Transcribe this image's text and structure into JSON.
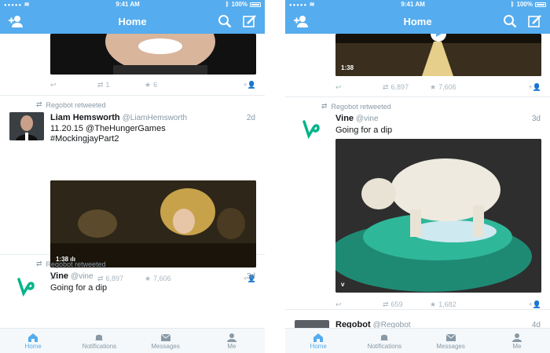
{
  "status": {
    "time": "9:41 AM",
    "battery": "100%"
  },
  "nav": {
    "title": "Home"
  },
  "tabs": [
    {
      "label": "Home",
      "icon": "home-icon",
      "active": true
    },
    {
      "label": "Notifications",
      "icon": "bell-icon",
      "active": false
    },
    {
      "label": "Messages",
      "icon": "mail-icon",
      "active": false
    },
    {
      "label": "Me",
      "icon": "person-icon",
      "active": false
    }
  ],
  "left": {
    "top_tweet": {
      "retweets": "1",
      "favorites": "6"
    },
    "tweet1": {
      "retweeted_by": "Regobot retweeted",
      "name": "Liam Hemsworth",
      "handle": "@LiamHemsworth",
      "time": "2d",
      "text_line1": "11.20.15 @TheHungerGames",
      "text_line2": "#MockingjayPart2",
      "duration": "1:38",
      "retweets": "6,897",
      "favorites": "7,606"
    },
    "tweet2": {
      "retweeted_by": "Regobot retweeted",
      "name": "Vine",
      "handle": "@vine",
      "time": "3d",
      "text": "Going for a dip"
    }
  },
  "right": {
    "top_tweet": {
      "duration": "1:38",
      "retweets": "6,897",
      "favorites": "7,606"
    },
    "tweet1": {
      "retweeted_by": "Regobot retweeted",
      "name": "Vine",
      "handle": "@vine",
      "time": "3d",
      "text": "Going for a dip",
      "retweets": "659",
      "favorites": "1,682"
    },
    "tweet2": {
      "name": "Regobot",
      "handle": "@Regobot",
      "time": "4d"
    }
  },
  "colors": {
    "accent": "#55acee",
    "vine_green": "#00b489"
  }
}
